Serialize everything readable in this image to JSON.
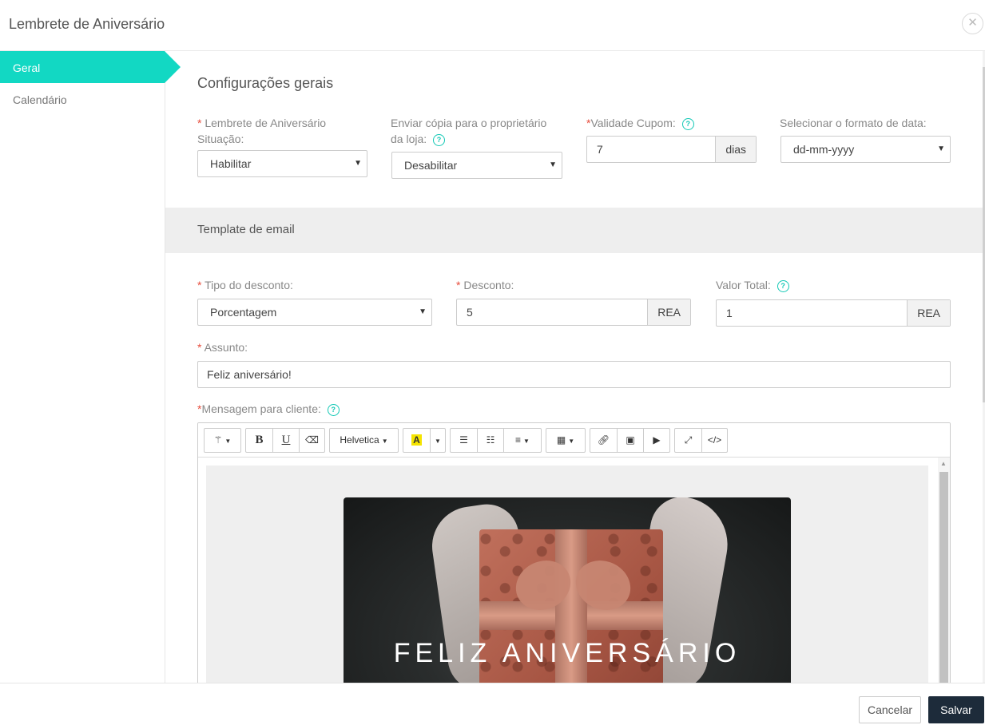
{
  "modal": {
    "title": "Lembrete de Aniversário",
    "close_symbol": "✕"
  },
  "sidebar": {
    "items": [
      {
        "label": "Geral",
        "active": true
      },
      {
        "label": "Calendário",
        "active": false
      }
    ]
  },
  "general": {
    "title": "Configurações gerais",
    "status": {
      "label_line1": "Lembrete de Aniversário",
      "label_line2": "Situação:",
      "value": "Habilitar"
    },
    "copy_owner": {
      "label_line1": "Enviar cópia para o proprietário",
      "label_line2": "da loja:",
      "value": "Desabilitar"
    },
    "coupon_validity": {
      "label": "Validade Cupom:",
      "value": "7",
      "unit": "dias"
    },
    "date_format": {
      "label": "Selecionar o formato de data:",
      "value": "dd-mm-yyyy"
    }
  },
  "template": {
    "title": "Template de email",
    "discount_type": {
      "label": "Tipo do desconto:",
      "value": "Porcentagem"
    },
    "discount": {
      "label": "Desconto:",
      "value": "5",
      "unit": "REA"
    },
    "total_value": {
      "label": "Valor Total:",
      "value": "1",
      "unit": "REA"
    },
    "subject": {
      "label": "Assunto:",
      "value": "Feliz aniversário!"
    },
    "message": {
      "label": "Mensagem para cliente:"
    }
  },
  "editor": {
    "toolbar": {
      "font": "Helvetica",
      "bold": "B",
      "underline": "U",
      "color": "A",
      "code": "</>"
    },
    "hero_text": "FELIZ ANIVERSÁRIO"
  },
  "footer": {
    "cancel": "Cancelar",
    "save": "Salvar"
  },
  "colors": {
    "accent": "#12d8c3",
    "primary_button": "#1d2b3a",
    "required": "#e74c3c"
  }
}
